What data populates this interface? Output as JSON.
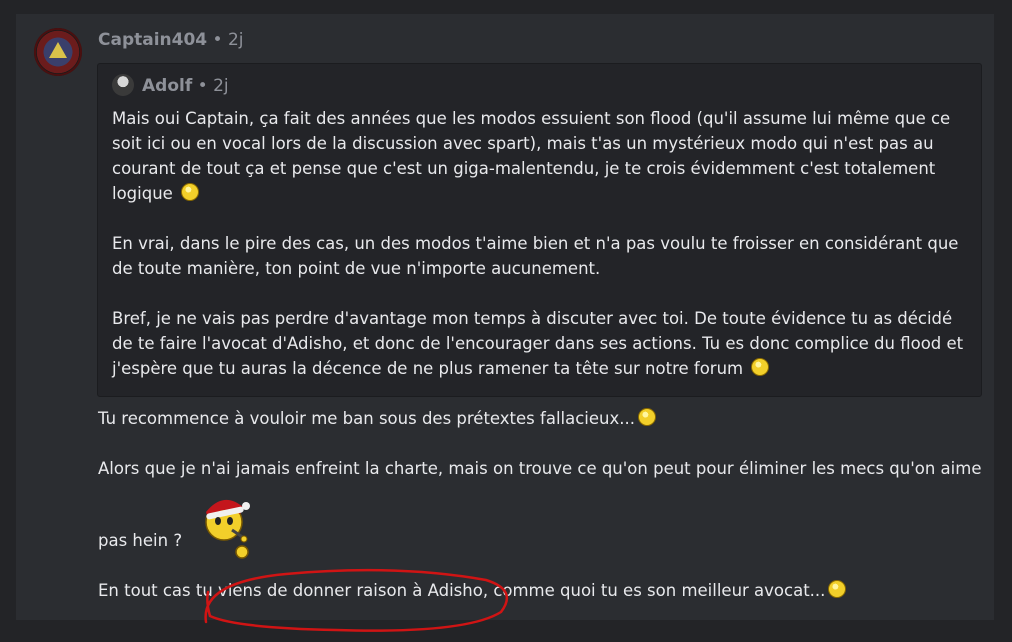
{
  "post": {
    "author": "Captain404",
    "separator": "•",
    "time": "2j",
    "quote": {
      "author": "Adolf",
      "separator": "•",
      "time": "2j",
      "paragraphs": [
        "Mais oui Captain, ça fait des années que les modos essuient son flood (qu'il assume lui même que ce soit ici ou en vocal lors de la discussion avec spart), mais t'as un mystérieux modo qui n'est pas au courant de tout ça et pense que c'est un giga-malentendu, je te crois évidemment c'est totalement logique",
        "En vrai, dans le pire des cas, un des modos t'aime bien et n'a pas voulu te froisser en considérant que de toute manière, ton point de vue n'importe aucunement.",
        "Bref, je ne vais pas perdre d'avantage mon temps à discuter avec toi. De toute évidence tu as décidé de te faire l'avocat d'Adisho, et donc de l'encourager dans ses actions. Tu es donc complice du flood et j'espère que tu auras la décence de ne plus ramener ta tête sur notre forum"
      ]
    },
    "body": {
      "line1": "Tu recommence à vouloir me ban sous des prétextes fallacieux...",
      "line2": "Alors que je n'ai jamais enfreint la charte, mais on trouve ce qu'on peut pour éliminer les mecs qu'on aime",
      "line3": "pas hein ?",
      "line4": "En tout cas tu viens de donner raison à Adisho, comme quoi tu es son meilleur avocat..."
    }
  },
  "colors": {
    "background": "#232427",
    "card": "#2b2d31",
    "quote_bg": "#232428",
    "muted_text": "#8e9199",
    "text": "#e8e9ec",
    "annotation_red": "#d01414"
  }
}
